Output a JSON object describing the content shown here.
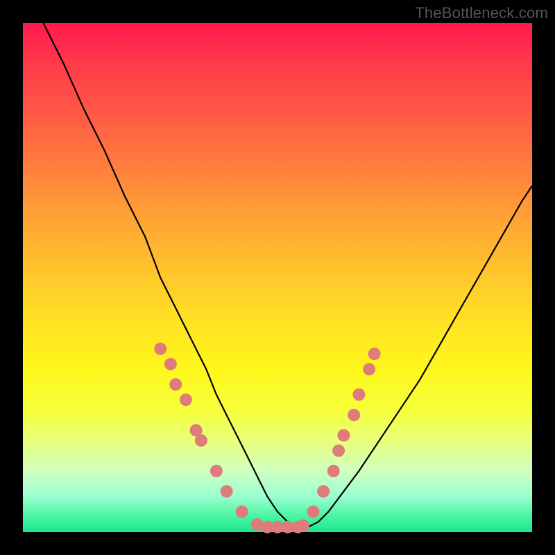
{
  "watermark": "TheBottleneck.com",
  "chart_data": {
    "type": "line",
    "title": "",
    "xlabel": "",
    "ylabel": "",
    "xlim": [
      0,
      100
    ],
    "ylim": [
      0,
      100
    ],
    "background": "red-to-green vertical gradient (red top, green bottom)",
    "series": [
      {
        "name": "bottleneck-curve",
        "x": [
          4,
          8,
          12,
          16,
          20,
          24,
          27,
          30,
          33,
          36,
          38,
          40,
          42,
          44,
          46,
          48,
          50,
          52,
          54,
          56,
          58,
          60,
          63,
          66,
          70,
          74,
          78,
          82,
          86,
          90,
          94,
          98,
          100
        ],
        "y": [
          100,
          92,
          83,
          75,
          66,
          58,
          50,
          44,
          38,
          32,
          27,
          23,
          19,
          15,
          11,
          7,
          4,
          2,
          1,
          1,
          2,
          4,
          8,
          12,
          18,
          24,
          30,
          37,
          44,
          51,
          58,
          65,
          68
        ]
      }
    ],
    "markers": [
      {
        "name": "left-cluster",
        "points": [
          {
            "x": 27,
            "y": 36
          },
          {
            "x": 29,
            "y": 33
          },
          {
            "x": 30,
            "y": 29
          },
          {
            "x": 32,
            "y": 26
          },
          {
            "x": 34,
            "y": 20
          },
          {
            "x": 35,
            "y": 18
          },
          {
            "x": 38,
            "y": 12
          },
          {
            "x": 40,
            "y": 8
          },
          {
            "x": 43,
            "y": 4
          }
        ]
      },
      {
        "name": "valley-cluster",
        "points": [
          {
            "x": 46,
            "y": 1.5
          },
          {
            "x": 48,
            "y": 1
          },
          {
            "x": 50,
            "y": 1
          },
          {
            "x": 52,
            "y": 1
          },
          {
            "x": 54,
            "y": 1
          },
          {
            "x": 55,
            "y": 1.3
          }
        ]
      },
      {
        "name": "right-cluster",
        "points": [
          {
            "x": 57,
            "y": 4
          },
          {
            "x": 59,
            "y": 8
          },
          {
            "x": 61,
            "y": 12
          },
          {
            "x": 62,
            "y": 16
          },
          {
            "x": 63,
            "y": 19
          },
          {
            "x": 65,
            "y": 23
          },
          {
            "x": 66,
            "y": 27
          },
          {
            "x": 68,
            "y": 32
          },
          {
            "x": 69,
            "y": 35
          }
        ]
      }
    ],
    "annotations": []
  },
  "colors": {
    "frame": "#000000",
    "curve": "#000000",
    "markers": "#df7b7b",
    "gradient_top": "#ff1a4d",
    "gradient_bottom": "#1de590"
  }
}
